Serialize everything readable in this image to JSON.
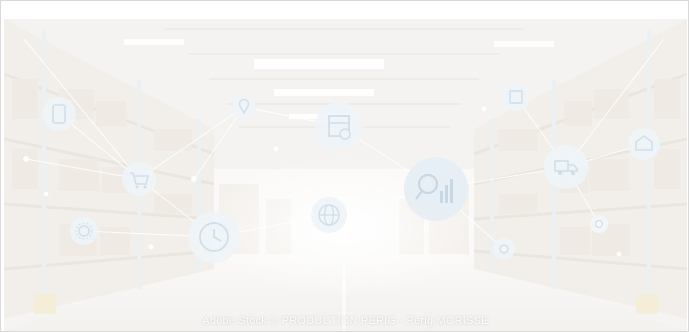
{
  "photo": {
    "credit": "Adobe Stock © PRODUCTION PERIG - Perig MORISSE"
  },
  "icons": [
    "tablet-icon",
    "shopping-cart-icon",
    "delivery-truck-icon",
    "package-icon",
    "search-chart-icon",
    "globe-icon",
    "clock-icon",
    "location-pin-icon",
    "gear-icon",
    "warehouse-icon",
    "box-icon",
    "settings-icon"
  ],
  "colors": {
    "icon_badge": "#dbe9f2",
    "icon_stroke": "#9fbcd1",
    "network_line": "#ffffff"
  }
}
